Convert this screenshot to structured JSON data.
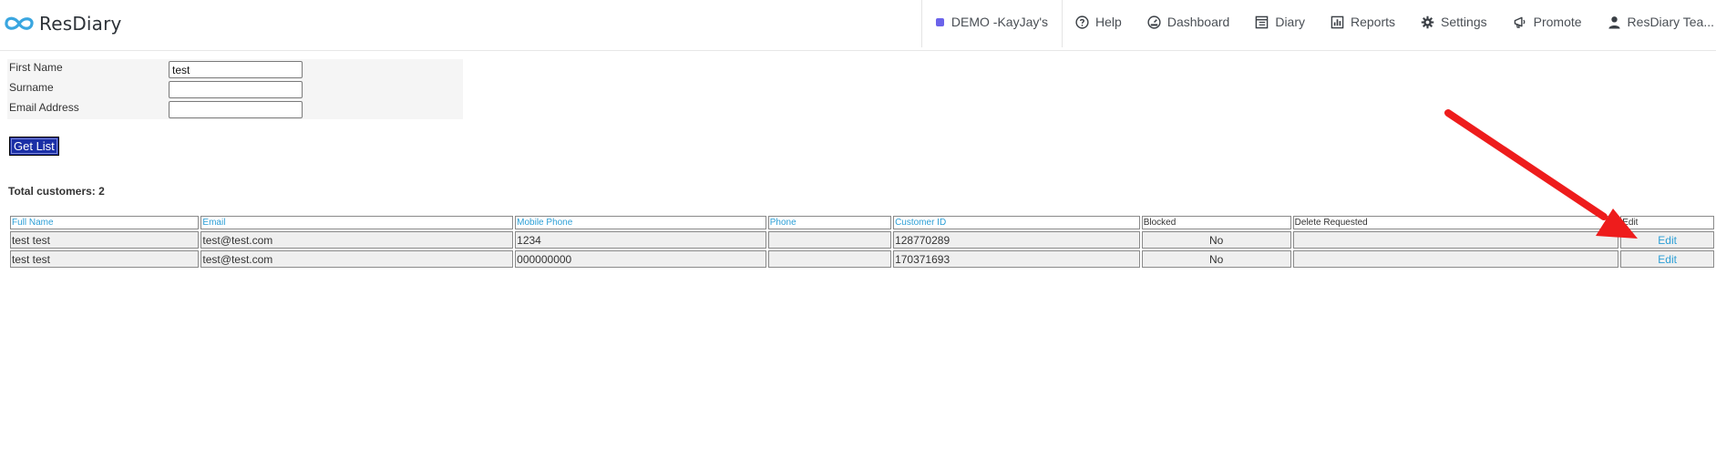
{
  "app": {
    "logo_text": "ResDiary"
  },
  "nav": {
    "venue": "DEMO -KayJay's",
    "items": [
      {
        "label": "Help",
        "icon": "help-icon"
      },
      {
        "label": "Dashboard",
        "icon": "dashboard-icon"
      },
      {
        "label": "Diary",
        "icon": "diary-icon"
      },
      {
        "label": "Reports",
        "icon": "reports-icon"
      },
      {
        "label": "Settings",
        "icon": "settings-icon"
      },
      {
        "label": "Promote",
        "icon": "megaphone-icon"
      }
    ],
    "user": "ResDiary Tea..."
  },
  "search": {
    "first_name_label": "First Name",
    "first_name_value": "test",
    "surname_label": "Surname",
    "surname_value": "",
    "email_label": "Email Address",
    "email_value": "",
    "button_label": "Get List"
  },
  "results": {
    "total_text": "Total customers: 2",
    "columns": [
      "Full Name",
      "Email",
      "Mobile Phone",
      "Phone",
      "Customer ID",
      "Blocked",
      "Delete Requested",
      "Edit"
    ],
    "rows": [
      {
        "full_name": "test test",
        "email": "test@test.com",
        "mobile": "1234",
        "phone": "",
        "customer_id": "128770289",
        "blocked": "No",
        "delete_requested": "",
        "edit": "Edit"
      },
      {
        "full_name": "test test",
        "email": "test@test.com",
        "mobile": "000000000",
        "phone": "",
        "customer_id": "170371693",
        "blocked": "No",
        "delete_requested": "",
        "edit": "Edit"
      }
    ]
  },
  "colors": {
    "accent": "#2c9fd6",
    "venue_dot": "#6b63ea",
    "button_bg": "#1b2fa6",
    "annotation_arrow": "#ee1c1c"
  }
}
